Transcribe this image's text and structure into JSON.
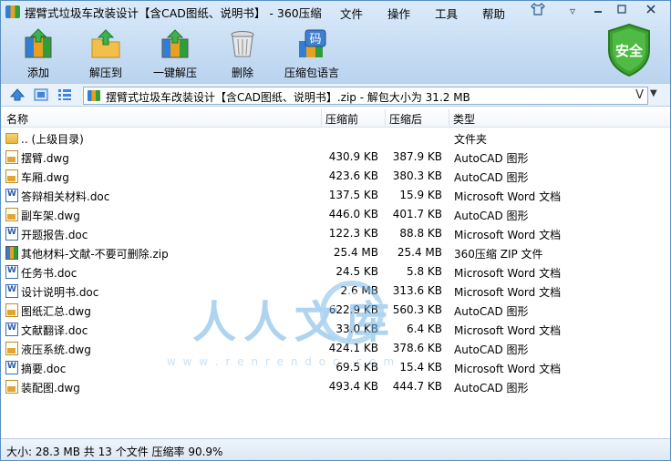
{
  "window": {
    "title": "摆臂式垃圾车改装设计【含CAD图纸、说明书】 - 360压缩"
  },
  "menu": [
    "文件",
    "操作",
    "工具",
    "帮助"
  ],
  "toolbar": [
    {
      "label": "添加",
      "icon": "add-archive-icon"
    },
    {
      "label": "解压到",
      "icon": "extract-to-icon"
    },
    {
      "label": "一键解压",
      "icon": "one-click-extract-icon"
    },
    {
      "label": "删除",
      "icon": "trash-icon"
    },
    {
      "label": "压缩包语言",
      "icon": "archive-language-icon",
      "badge": "码"
    }
  ],
  "security": {
    "label": "安全",
    "color": "#3da133"
  },
  "address": {
    "path": "摆臂式垃圾车改装设计【含CAD图纸、说明书】.zip - 解包大小为 31.2 MB",
    "mark": "V"
  },
  "columns": {
    "name": "名称",
    "size": "压缩前",
    "packed": "压缩后",
    "type": "类型"
  },
  "rows": [
    {
      "name": ".. (上级目录)",
      "size": "",
      "packed": "",
      "type": "文件夹",
      "kind": "folder"
    },
    {
      "name": "摆臂.dwg",
      "size": "430.9 KB",
      "packed": "387.9 KB",
      "type": "AutoCAD 图形",
      "kind": "dwg"
    },
    {
      "name": "车厢.dwg",
      "size": "423.6 KB",
      "packed": "380.3 KB",
      "type": "AutoCAD 图形",
      "kind": "dwg"
    },
    {
      "name": "答辩相关材料.doc",
      "size": "137.5 KB",
      "packed": "15.9 KB",
      "type": "Microsoft Word 文档",
      "kind": "doc"
    },
    {
      "name": "副车架.dwg",
      "size": "446.0 KB",
      "packed": "401.7 KB",
      "type": "AutoCAD 图形",
      "kind": "dwg"
    },
    {
      "name": "开题报告.doc",
      "size": "122.3 KB",
      "packed": "88.8 KB",
      "type": "Microsoft Word 文档",
      "kind": "doc"
    },
    {
      "name": "其他材料-文献-不要可删除.zip",
      "size": "25.4 MB",
      "packed": "25.4 MB",
      "type": "360压缩 ZIP 文件",
      "kind": "zip"
    },
    {
      "name": "任务书.doc",
      "size": "24.5 KB",
      "packed": "5.8 KB",
      "type": "Microsoft Word 文档",
      "kind": "doc"
    },
    {
      "name": "设计说明书.doc",
      "size": "2.6 MB",
      "packed": "313.6 KB",
      "type": "Microsoft Word 文档",
      "kind": "doc"
    },
    {
      "name": "图纸汇总.dwg",
      "size": "622.9 KB",
      "packed": "560.3 KB",
      "type": "AutoCAD 图形",
      "kind": "dwg"
    },
    {
      "name": "文献翻译.doc",
      "size": "33.0 KB",
      "packed": "6.4 KB",
      "type": "Microsoft Word 文档",
      "kind": "doc"
    },
    {
      "name": "液压系统.dwg",
      "size": "424.1 KB",
      "packed": "378.6 KB",
      "type": "AutoCAD 图形",
      "kind": "dwg"
    },
    {
      "name": "摘要.doc",
      "size": "69.5 KB",
      "packed": "15.4 KB",
      "type": "Microsoft Word 文档",
      "kind": "doc"
    },
    {
      "name": "装配图.dwg",
      "size": "493.4 KB",
      "packed": "444.7 KB",
      "type": "AutoCAD 图形",
      "kind": "dwg"
    }
  ],
  "watermark": {
    "text": "人人文库",
    "url": "w w w . r e n r e n d o c . c o m"
  },
  "status": "大小: 28.3 MB 共 13 个文件 压缩率 90.9%"
}
